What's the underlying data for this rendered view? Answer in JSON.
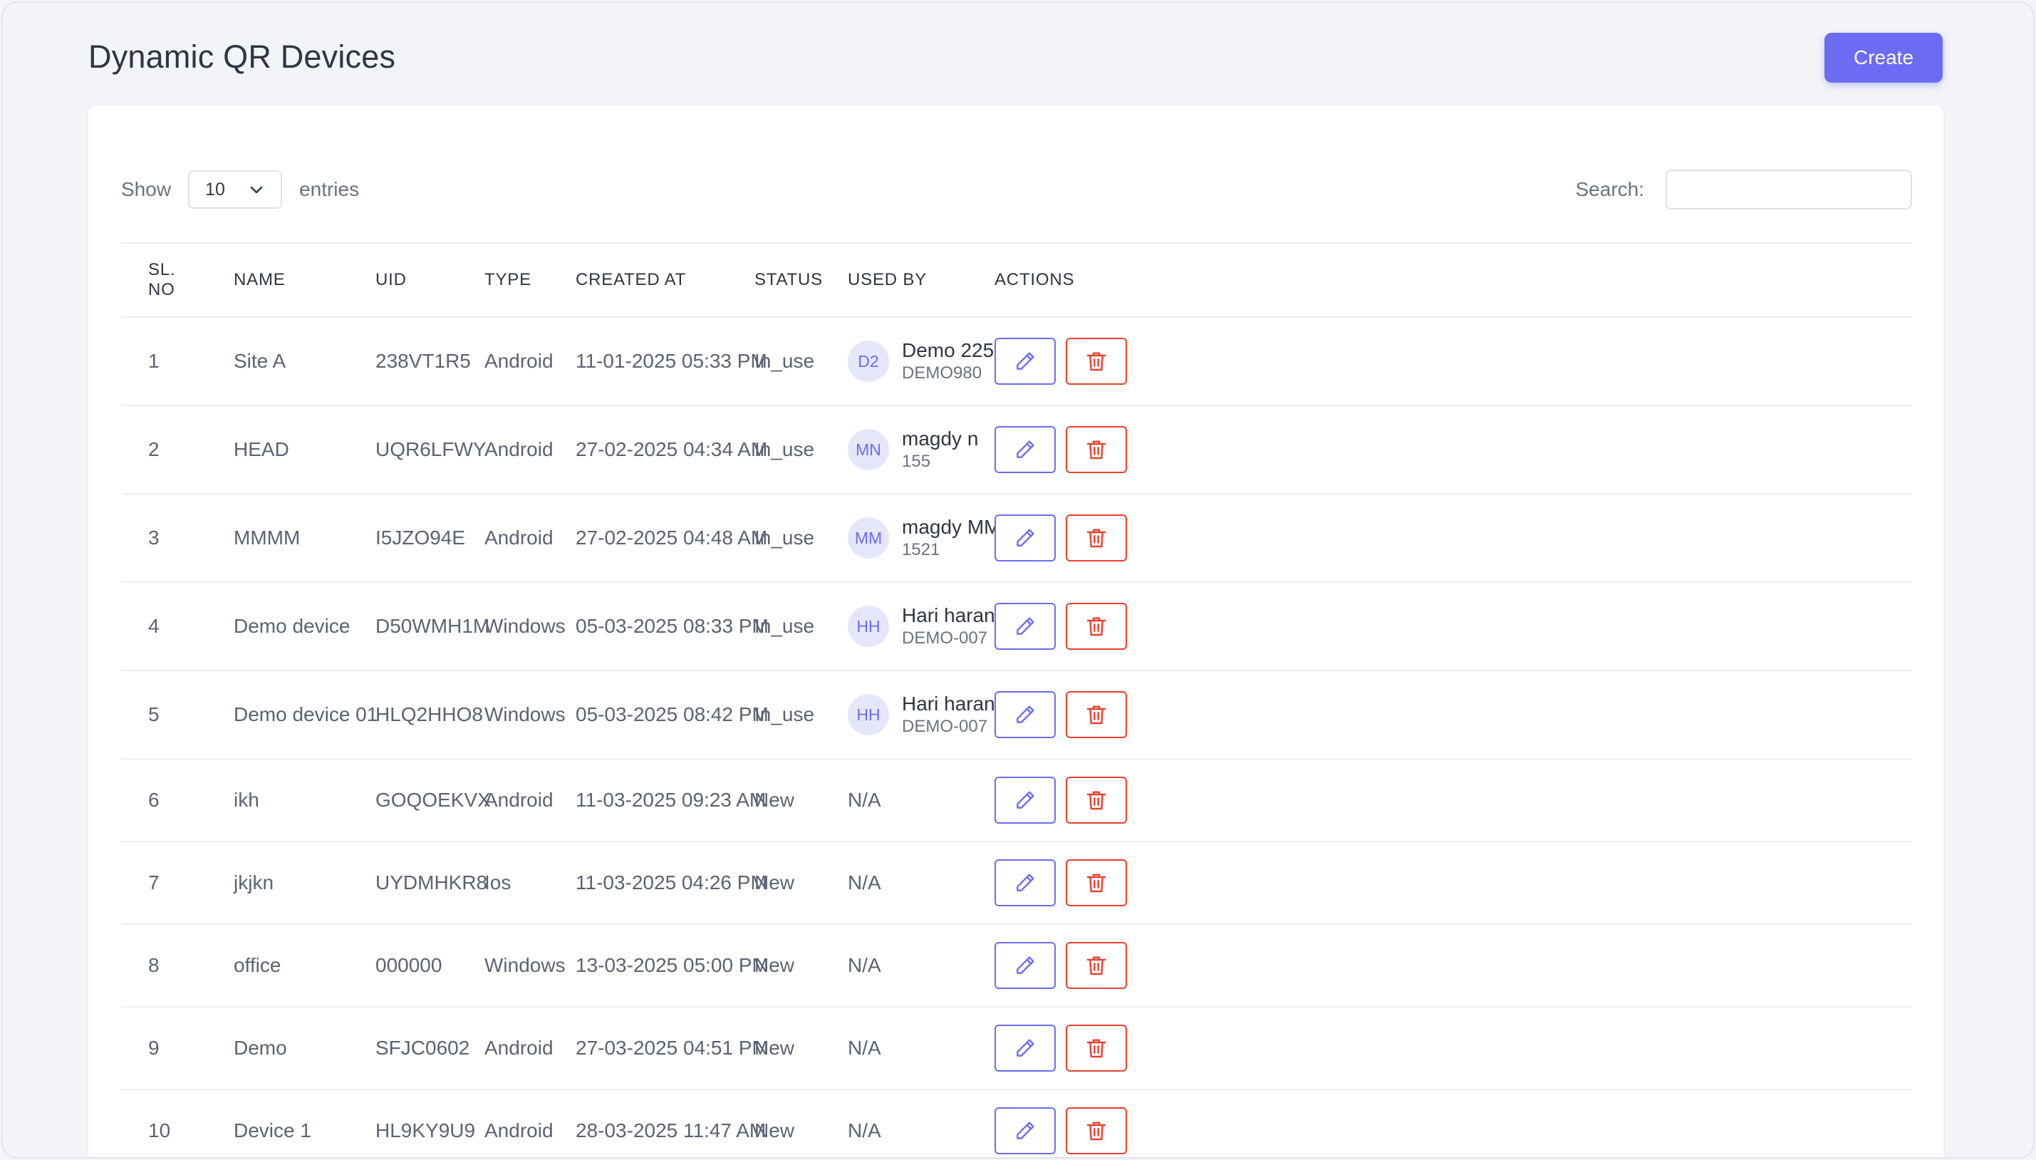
{
  "page": {
    "title": "Dynamic QR Devices",
    "create_label": "Create"
  },
  "controls": {
    "show_label": "Show",
    "entries_value": "10",
    "entries_label": "entries",
    "search_label": "Search:",
    "search_value": ""
  },
  "table": {
    "headers": [
      "SL. NO",
      "NAME",
      "UID",
      "TYPE",
      "CREATED AT",
      "STATUS",
      "USED BY",
      "ACTIONS"
    ],
    "rows": [
      {
        "sl": "1",
        "name": "Site A",
        "uid": "238VT1R5",
        "type": "Android",
        "created": "11-01-2025 05:33 PM",
        "status": "In_use",
        "used_by": {
          "initials": "D2",
          "name": "Demo 225",
          "code": "DEMO980"
        }
      },
      {
        "sl": "2",
        "name": "HEAD",
        "uid": "UQR6LFWY",
        "type": "Android",
        "created": "27-02-2025 04:34 AM",
        "status": "In_use",
        "used_by": {
          "initials": "MN",
          "name": "magdy n",
          "code": "155"
        }
      },
      {
        "sl": "3",
        "name": "MMMM",
        "uid": "I5JZO94E",
        "type": "Android",
        "created": "27-02-2025 04:48 AM",
        "status": "In_use",
        "used_by": {
          "initials": "MM",
          "name": "magdy MM",
          "code": "1521"
        }
      },
      {
        "sl": "4",
        "name": "Demo device",
        "uid": "D50WMH1M",
        "type": "Windows",
        "created": "05-03-2025 08:33 PM",
        "status": "In_use",
        "used_by": {
          "initials": "HH",
          "name": "Hari haran",
          "code": "DEMO-007"
        }
      },
      {
        "sl": "5",
        "name": "Demo device 01",
        "uid": "HLQ2HHO8",
        "type": "Windows",
        "created": "05-03-2025 08:42 PM",
        "status": "In_use",
        "used_by": {
          "initials": "HH",
          "name": "Hari haran",
          "code": "DEMO-007"
        }
      },
      {
        "sl": "6",
        "name": "ikh",
        "uid": "GOQOEKVX",
        "type": "Android",
        "created": "11-03-2025 09:23 AM",
        "status": "New",
        "used_by_text": "N/A"
      },
      {
        "sl": "7",
        "name": "jkjkn",
        "uid": "UYDMHKR8",
        "type": "Ios",
        "created": "11-03-2025 04:26 PM",
        "status": "New",
        "used_by_text": "N/A"
      },
      {
        "sl": "8",
        "name": "office",
        "uid": "000000",
        "type": "Windows",
        "created": "13-03-2025 05:00 PM",
        "status": "New",
        "used_by_text": "N/A"
      },
      {
        "sl": "9",
        "name": "Demo",
        "uid": "SFJC0602",
        "type": "Android",
        "created": "27-03-2025 04:51 PM",
        "status": "New",
        "used_by_text": "N/A"
      },
      {
        "sl": "10",
        "name": "Device 1",
        "uid": "HL9KY9U9",
        "type": "Android",
        "created": "28-03-2025 11:47 AM",
        "status": "New",
        "used_by_text": "N/A"
      }
    ]
  },
  "icons": {
    "edit": "pencil-icon",
    "delete": "trash-icon",
    "dropdown": "chevron-down-icon"
  },
  "colors": {
    "accent": "#6b6cf3",
    "danger": "#e8412d",
    "avatar_bg": "#e6e6fb"
  }
}
